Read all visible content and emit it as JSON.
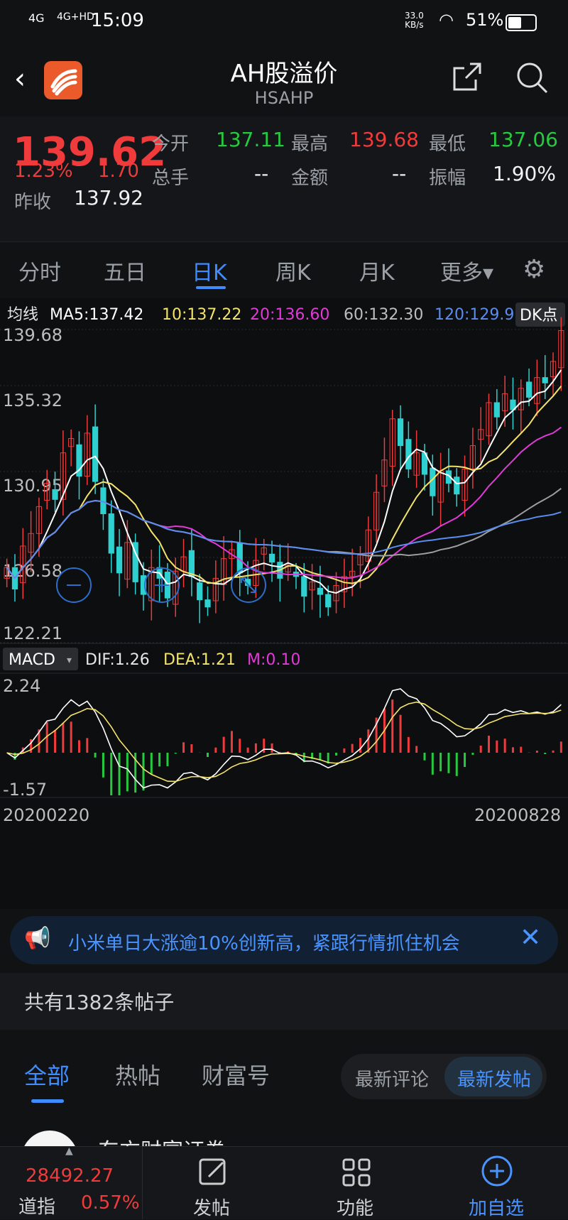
{
  "status": {
    "net1": "4G",
    "net2": "4G+HD",
    "time": "15:09",
    "speed_value": "33.0",
    "speed_unit": "KB/s",
    "battery": "51%"
  },
  "header": {
    "title": "AH股溢价",
    "code": "HSAHP"
  },
  "quote": {
    "price": "139.62",
    "change_pct": "1.23%",
    "change": "1.70",
    "prev_close_label": "昨收",
    "prev_close": "137.92",
    "open_label": "今开",
    "open": "137.11",
    "high_label": "最高",
    "high": "139.68",
    "low_label": "最低",
    "low": "137.06",
    "volume_label": "总手",
    "volume": "--",
    "amount_label": "金额",
    "amount": "--",
    "amplitude_label": "振幅",
    "amplitude": "1.90%"
  },
  "tabs": [
    "分时",
    "五日",
    "日K",
    "周K",
    "月K",
    "更多▾"
  ],
  "active_tab": "日K",
  "ma_bar": {
    "label": "均线",
    "ma5": "MA5:137.42",
    "ma10": "10:137.22",
    "ma20": "20:136.60",
    "ma60": "60:132.30",
    "ma120": "120:129.9",
    "dk": "DK点"
  },
  "colors": {
    "ma5": "#ffffff",
    "ma10": "#f4e36a",
    "ma20": "#e23ad8",
    "ma60": "#9e9e9e",
    "ma120": "#5b8def",
    "ma250": "#8fb3ff",
    "up": "#ef3b3b",
    "down": "#2fd0d0",
    "accent": "#3f8cff"
  },
  "axis": {
    "y_labels": [
      "139.68",
      "135.32",
      "130.95",
      "126.58",
      "122.21"
    ],
    "x_start": "20200220",
    "x_end": "20200828"
  },
  "macd": {
    "label": "MACD",
    "dif": "DIF:1.26",
    "dea": "DEA:1.21",
    "m": "M:0.10",
    "top": "2.24",
    "bottom": "-1.57"
  },
  "chart_data": {
    "type": "candlestick",
    "range": [
      122.21,
      139.68
    ],
    "close_series": [
      126.4,
      125.2,
      127.6,
      128.3,
      129.8,
      131.1,
      130.2,
      132.8,
      133.6,
      131.5,
      133.9,
      131.2,
      129.4,
      127.2,
      126.1,
      127.8,
      125.6,
      124.9,
      126.4,
      125.8,
      124.7,
      126.2,
      127.0,
      125.9,
      124.6,
      124.2,
      125.8,
      126.9,
      127.4,
      126.1,
      125.4,
      126.8,
      127.5,
      126.7,
      125.8,
      126.5,
      125.9,
      124.8,
      125.6,
      124.9,
      124.2,
      125.4,
      125.9,
      126.2,
      127.1,
      128.5,
      130.6,
      132.4,
      134.7,
      133.2,
      131.9,
      132.8,
      131.6,
      130.4,
      131.8,
      131.1,
      130.5,
      131.9,
      133.2,
      134.1,
      135.6,
      134.8,
      136.1,
      135.2,
      136.4,
      135.9,
      137.0,
      136.7,
      137.9,
      139.62
    ]
  },
  "banner": {
    "text": "小米单日大涨逾10%创新高，紧跟行情抓住机会"
  },
  "posts": {
    "count_text": "共有1382条帖子",
    "tabs": [
      "全部",
      "热帖",
      "财富号"
    ],
    "sort": [
      "最新评论",
      "最新发帖"
    ],
    "author": "东方财富证券"
  },
  "bottom_nav": {
    "index_value": "28492.27",
    "index_name": "道指",
    "index_pct": "0.57%",
    "post": "发帖",
    "func": "功能",
    "add": "加自选"
  }
}
